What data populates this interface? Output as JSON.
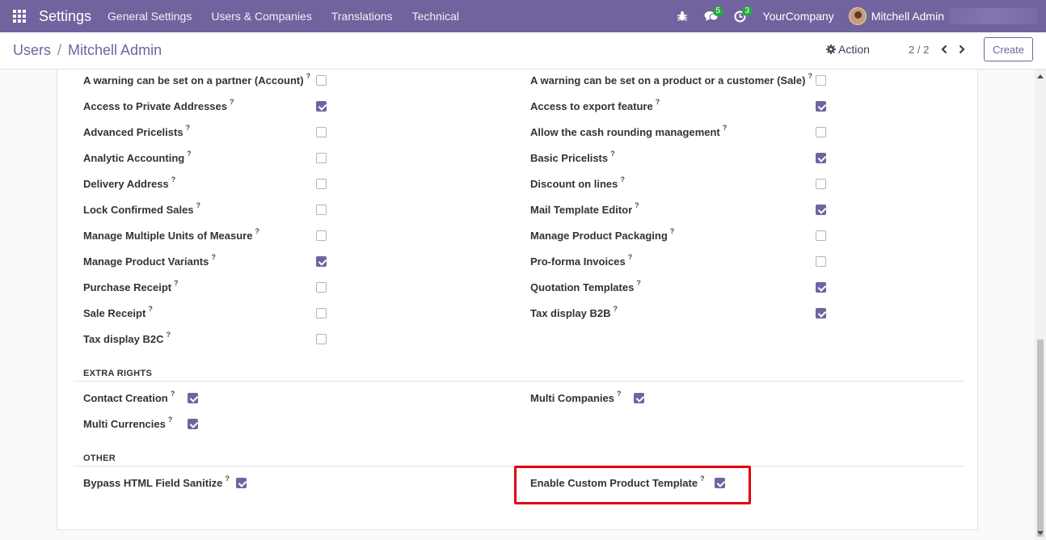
{
  "navbar": {
    "brand": "Settings",
    "menu": [
      "General Settings",
      "Users & Companies",
      "Translations",
      "Technical"
    ],
    "messages_count": "5",
    "activities_count": "3",
    "company": "YourCompany",
    "user": "Mitchell Admin"
  },
  "control": {
    "breadcrumb_parent": "Users",
    "breadcrumb_sep": "/",
    "breadcrumb_current": "Mitchell Admin",
    "action_label": "Action",
    "pager": "2 / 2",
    "create_label": "Create"
  },
  "technical_settings": {
    "left": [
      {
        "label": "A warning can be set on a partner (Account)",
        "checked": false
      },
      {
        "label": "Access to Private Addresses",
        "checked": true
      },
      {
        "label": "Advanced Pricelists",
        "checked": false
      },
      {
        "label": "Analytic Accounting",
        "checked": false
      },
      {
        "label": "Delivery Address",
        "checked": false
      },
      {
        "label": "Lock Confirmed Sales",
        "checked": false
      },
      {
        "label": "Manage Multiple Units of Measure",
        "checked": false
      },
      {
        "label": "Manage Product Variants",
        "checked": true
      },
      {
        "label": "Purchase Receipt",
        "checked": false
      },
      {
        "label": "Sale Receipt",
        "checked": false
      },
      {
        "label": "Tax display B2C",
        "checked": false
      }
    ],
    "right": [
      {
        "label": "A warning can be set on a product or a customer (Sale)",
        "checked": false
      },
      {
        "label": "Access to export feature",
        "checked": true
      },
      {
        "label": "Allow the cash rounding management",
        "checked": false
      },
      {
        "label": "Basic Pricelists",
        "checked": true
      },
      {
        "label": "Discount on lines",
        "checked": false
      },
      {
        "label": "Mail Template Editor",
        "checked": true
      },
      {
        "label": "Manage Product Packaging",
        "checked": false
      },
      {
        "label": "Pro-forma Invoices",
        "checked": false
      },
      {
        "label": "Quotation Templates",
        "checked": true
      },
      {
        "label": "Tax display B2B",
        "checked": true
      }
    ]
  },
  "extra_rights": {
    "title": "EXTRA RIGHTS",
    "left": [
      {
        "label": "Contact Creation",
        "checked": true
      },
      {
        "label": "Multi Currencies",
        "checked": true
      }
    ],
    "right": [
      {
        "label": "Multi Companies",
        "checked": true
      }
    ]
  },
  "other": {
    "title": "OTHER",
    "left": [
      {
        "label": "Bypass HTML Field Sanitize",
        "checked": true
      }
    ],
    "right": [
      {
        "label": "Enable Custom Product Template",
        "checked": true
      }
    ]
  },
  "help_marker": "?",
  "colors": {
    "brand": "#71639e",
    "highlight": "#e3000f",
    "badge": "#28a745"
  }
}
